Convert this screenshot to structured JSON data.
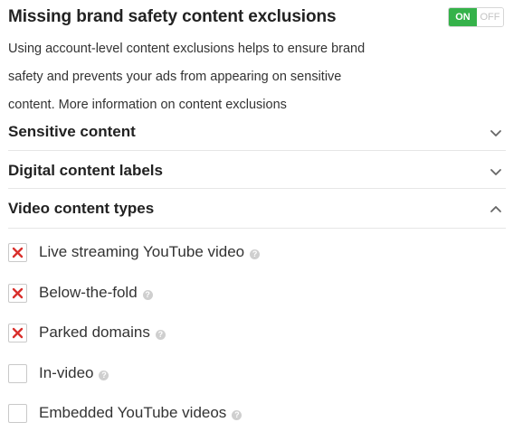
{
  "header": {
    "title": "Missing brand safety content exclusions",
    "toggle_on": "ON",
    "toggle_off": "OFF",
    "toggle_state": "on"
  },
  "description": {
    "line1": "Using account-level content exclusions helps to ensure brand",
    "line2": "safety and prevents your ads from appearing on sensitive",
    "line3": "content. More information on content exclusions"
  },
  "sections": [
    {
      "label": "Sensitive content",
      "expanded": false,
      "chevron": "chevron-down-icon"
    },
    {
      "label": "Digital content labels",
      "expanded": false,
      "chevron": "chevron-down-icon"
    },
    {
      "label": "Video content types",
      "expanded": true,
      "chevron": "chevron-up-icon"
    }
  ],
  "video_items": [
    {
      "label": "Live streaming YouTube video",
      "checked": true
    },
    {
      "label": "Below-the-fold",
      "checked": true
    },
    {
      "label": "Parked domains",
      "checked": true
    },
    {
      "label": "In-video",
      "checked": false
    },
    {
      "label": "Embedded YouTube videos",
      "checked": false
    }
  ],
  "help_glyph": "?",
  "colors": {
    "toggle_on": "#35b24a",
    "check_x": "#d9302c",
    "help_icon": "#cfcfcf"
  }
}
